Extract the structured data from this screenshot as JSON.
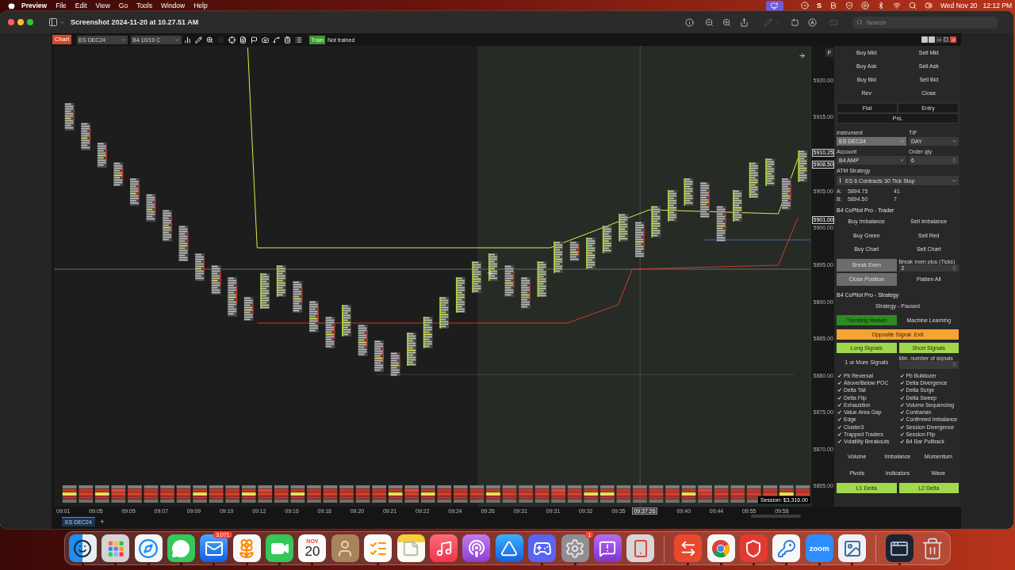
{
  "menu_bar": {
    "app": "Preview",
    "menus": [
      "File",
      "Edit",
      "View",
      "Go",
      "Tools",
      "Window",
      "Help"
    ],
    "status_letter": "S",
    "date": "Wed Nov 20",
    "time": "12:12 PM"
  },
  "window": {
    "title": "Screenshot 2024-11-20 at 10.27.51 AM",
    "toolbar": [
      {
        "disabled": false
      },
      {
        "disabled": false
      },
      {
        "disabled": false
      },
      {
        "disabled": false
      },
      {
        "disabled": true
      },
      {
        "disabled": false
      },
      {
        "disabled": false
      },
      {
        "disabled": true
      }
    ],
    "search": {
      "placeholder": "Search"
    }
  },
  "chart_toolbar": {
    "tab": "Chart",
    "instrument": "ES DEC24",
    "template": "B4 10/10 C",
    "tools": [
      {
        "disabled": false
      },
      {
        "disabled": false
      },
      {
        "disabled": false
      },
      {
        "disabled": true
      },
      {
        "disabled": false
      },
      {
        "disabled": false
      },
      {
        "disabled": false
      },
      {
        "disabled": false
      },
      {
        "disabled": false
      },
      {
        "disabled": false
      },
      {
        "disabled": false
      }
    ],
    "train_button": "Train",
    "train_status": "Not trained"
  },
  "chart": {
    "corner_button": "F",
    "price_labels": [
      {
        "text": "5920.00",
        "kind": "tick"
      },
      {
        "text": "5915.00",
        "kind": "tick"
      },
      {
        "text": "5910.25",
        "kind": "marker"
      },
      {
        "text": "5908.50",
        "kind": "marker"
      },
      {
        "text": "5905.00",
        "kind": "tick"
      },
      {
        "text": "5901.00",
        "kind": "marker"
      },
      {
        "text": "5900.00",
        "kind": "tick"
      },
      {
        "text": "5895.00",
        "kind": "tick"
      },
      {
        "text": "5890.00",
        "kind": "tick"
      },
      {
        "text": "5885.00",
        "kind": "tick"
      },
      {
        "text": "5880.00",
        "kind": "tick"
      },
      {
        "text": "5875.00",
        "kind": "tick"
      },
      {
        "text": "5870.00",
        "kind": "tick"
      },
      {
        "text": "5865.00",
        "kind": "tick"
      }
    ],
    "session_pnl": "Session: $3,316.00",
    "time_labels": [
      {
        "text": "09:01",
        "kind": "tick"
      },
      {
        "text": "09:05",
        "kind": "tick"
      },
      {
        "text": "09:05",
        "kind": "tick"
      },
      {
        "text": "09:07",
        "kind": "tick"
      },
      {
        "text": "09:09",
        "kind": "tick"
      },
      {
        "text": "09:10",
        "kind": "tick"
      },
      {
        "text": "09:12",
        "kind": "tick"
      },
      {
        "text": "09:16",
        "kind": "tick"
      },
      {
        "text": "09:18",
        "kind": "tick"
      },
      {
        "text": "09:20",
        "kind": "tick"
      },
      {
        "text": "09:21",
        "kind": "tick"
      },
      {
        "text": "09:22",
        "kind": "tick"
      },
      {
        "text": "09:24",
        "kind": "tick"
      },
      {
        "text": "09:26",
        "kind": "tick"
      },
      {
        "text": "09:31",
        "kind": "tick"
      },
      {
        "text": "09:31",
        "kind": "tick"
      },
      {
        "text": "09:32",
        "kind": "tick"
      },
      {
        "text": "09:35",
        "kind": "tick"
      },
      {
        "text": "09:37:26",
        "kind": "cursor"
      },
      {
        "text": "09:40",
        "kind": "tick"
      },
      {
        "text": "09:44",
        "kind": "tick"
      },
      {
        "text": "09:55",
        "kind": "tick"
      },
      {
        "text": "09:58",
        "kind": "tick"
      }
    ]
  },
  "order_panel": {
    "order_buttons": [
      "Buy Mkt",
      "Sell Mkt",
      "Buy Ask",
      "Sell Ask",
      "Buy Bid",
      "Sell Bid",
      "Rev",
      "Close"
    ],
    "position": {
      "status": "Flat",
      "entry": "Entry",
      "pnl": "PnL"
    },
    "instrument": {
      "label": "Instrument",
      "value": "ES DEC24",
      "disabled": true
    },
    "tif": {
      "label": "TIF",
      "value": "DAY"
    },
    "account": {
      "label": "Account",
      "value": "B4 AMP"
    },
    "order_qty": {
      "label": "Order qty",
      "value": "6"
    },
    "atm_strategy": {
      "label": "ATM Strategy",
      "value": "ES 6 Contracts 30 Tick Stop"
    },
    "quotes": [
      {
        "label": "A:",
        "price": "5894.75",
        "size": "41"
      },
      {
        "label": "B:",
        "price": "5894.50",
        "size": "7"
      }
    ],
    "trader": {
      "title": "B4 CoPilot Pro - Trader",
      "buttons": [
        "Buy Imbalance",
        "Sell Imbalance",
        "Buy Green",
        "Sell Red",
        "Buy Chart",
        "Sell Chart"
      ],
      "break_even": {
        "label": "Break Even",
        "disabled": true
      },
      "break_even_plus": {
        "label": "Break even plus (Ticks)",
        "value": "2"
      },
      "close_position": {
        "label": "Close Position",
        "disabled": true
      },
      "flatten_all": {
        "label": "Flatten All",
        "disabled": false
      }
    },
    "strategy": {
      "title": "B4 CoPilot Pro - Strategy",
      "status": "Strategy - Paused",
      "modes": [
        {
          "label": "Trending Market",
          "selected": true
        },
        {
          "label": "Machine Learning",
          "selected": false
        }
      ],
      "exit_button": "Opposite Signal  Exit",
      "signal_buttons": [
        "Long Signals",
        "Short Signals"
      ],
      "signal_count": "1 or More Signals",
      "min_signals": {
        "label": "Min. number of signals"
      },
      "signals": [
        {
          "label": "Pb Reversal",
          "checked": true
        },
        {
          "label": "Pb Bulldozer",
          "checked": true
        },
        {
          "label": "Above/Below POC",
          "checked": true
        },
        {
          "label": "Delta Divergence",
          "checked": true
        },
        {
          "label": "Delta Tail",
          "checked": true
        },
        {
          "label": "Delta Surge",
          "checked": true
        },
        {
          "label": "Delta Flip",
          "checked": true
        },
        {
          "label": "Delta Sweep",
          "checked": true
        },
        {
          "label": "Exhaustion",
          "checked": true
        },
        {
          "label": "Volume Sequencing",
          "checked": true
        },
        {
          "label": "Value Area Gap",
          "checked": true
        },
        {
          "label": "Contrarian",
          "checked": true
        },
        {
          "label": "Edge",
          "checked": true
        },
        {
          "label": "Confirmed Imbalance",
          "checked": true
        },
        {
          "label": "Cluster3",
          "checked": true
        },
        {
          "label": "Session Divergence",
          "checked": true
        },
        {
          "label": "Trapped Traders",
          "checked": true
        },
        {
          "label": "Session Flip",
          "checked": true
        },
        {
          "label": "Volatility Breakouts",
          "checked": true
        },
        {
          "label": "B4 Bar Pullback",
          "checked": true
        }
      ],
      "indicator_buttons": [
        "Volume",
        "Imbalance",
        "Momentum",
        "Pivots",
        "Indicators",
        "Wave"
      ],
      "delta_buttons": [
        "L1 Delta",
        "L2 Delta"
      ]
    }
  },
  "tabs": [
    {
      "label": "ES DEC24",
      "selected": true
    }
  ],
  "add_tab": "+",
  "dock": {
    "items": [
      {
        "running": true
      },
      {
        "running": true
      },
      {
        "running": true
      },
      {
        "running": true
      },
      {
        "running": true,
        "badge": "3,071"
      },
      {
        "running": true
      },
      {
        "running": true
      },
      {
        "running": true,
        "month": "NOV",
        "day": "20"
      },
      {
        "running": false
      },
      {
        "running": true
      },
      {
        "running": false
      },
      {
        "running": false
      },
      {
        "running": false
      },
      {
        "running": false
      },
      {
        "running": true
      },
      {
        "running": true,
        "badge": "1"
      },
      {
        "running": false
      },
      {
        "running": false
      },
      {
        "running": true
      },
      {
        "running": true
      },
      {
        "running": true
      },
      {
        "running": true
      },
      {
        "running": true,
        "label": "zoom"
      },
      {
        "running": true
      },
      {
        "running": true
      },
      {
        "running": false
      }
    ]
  }
}
